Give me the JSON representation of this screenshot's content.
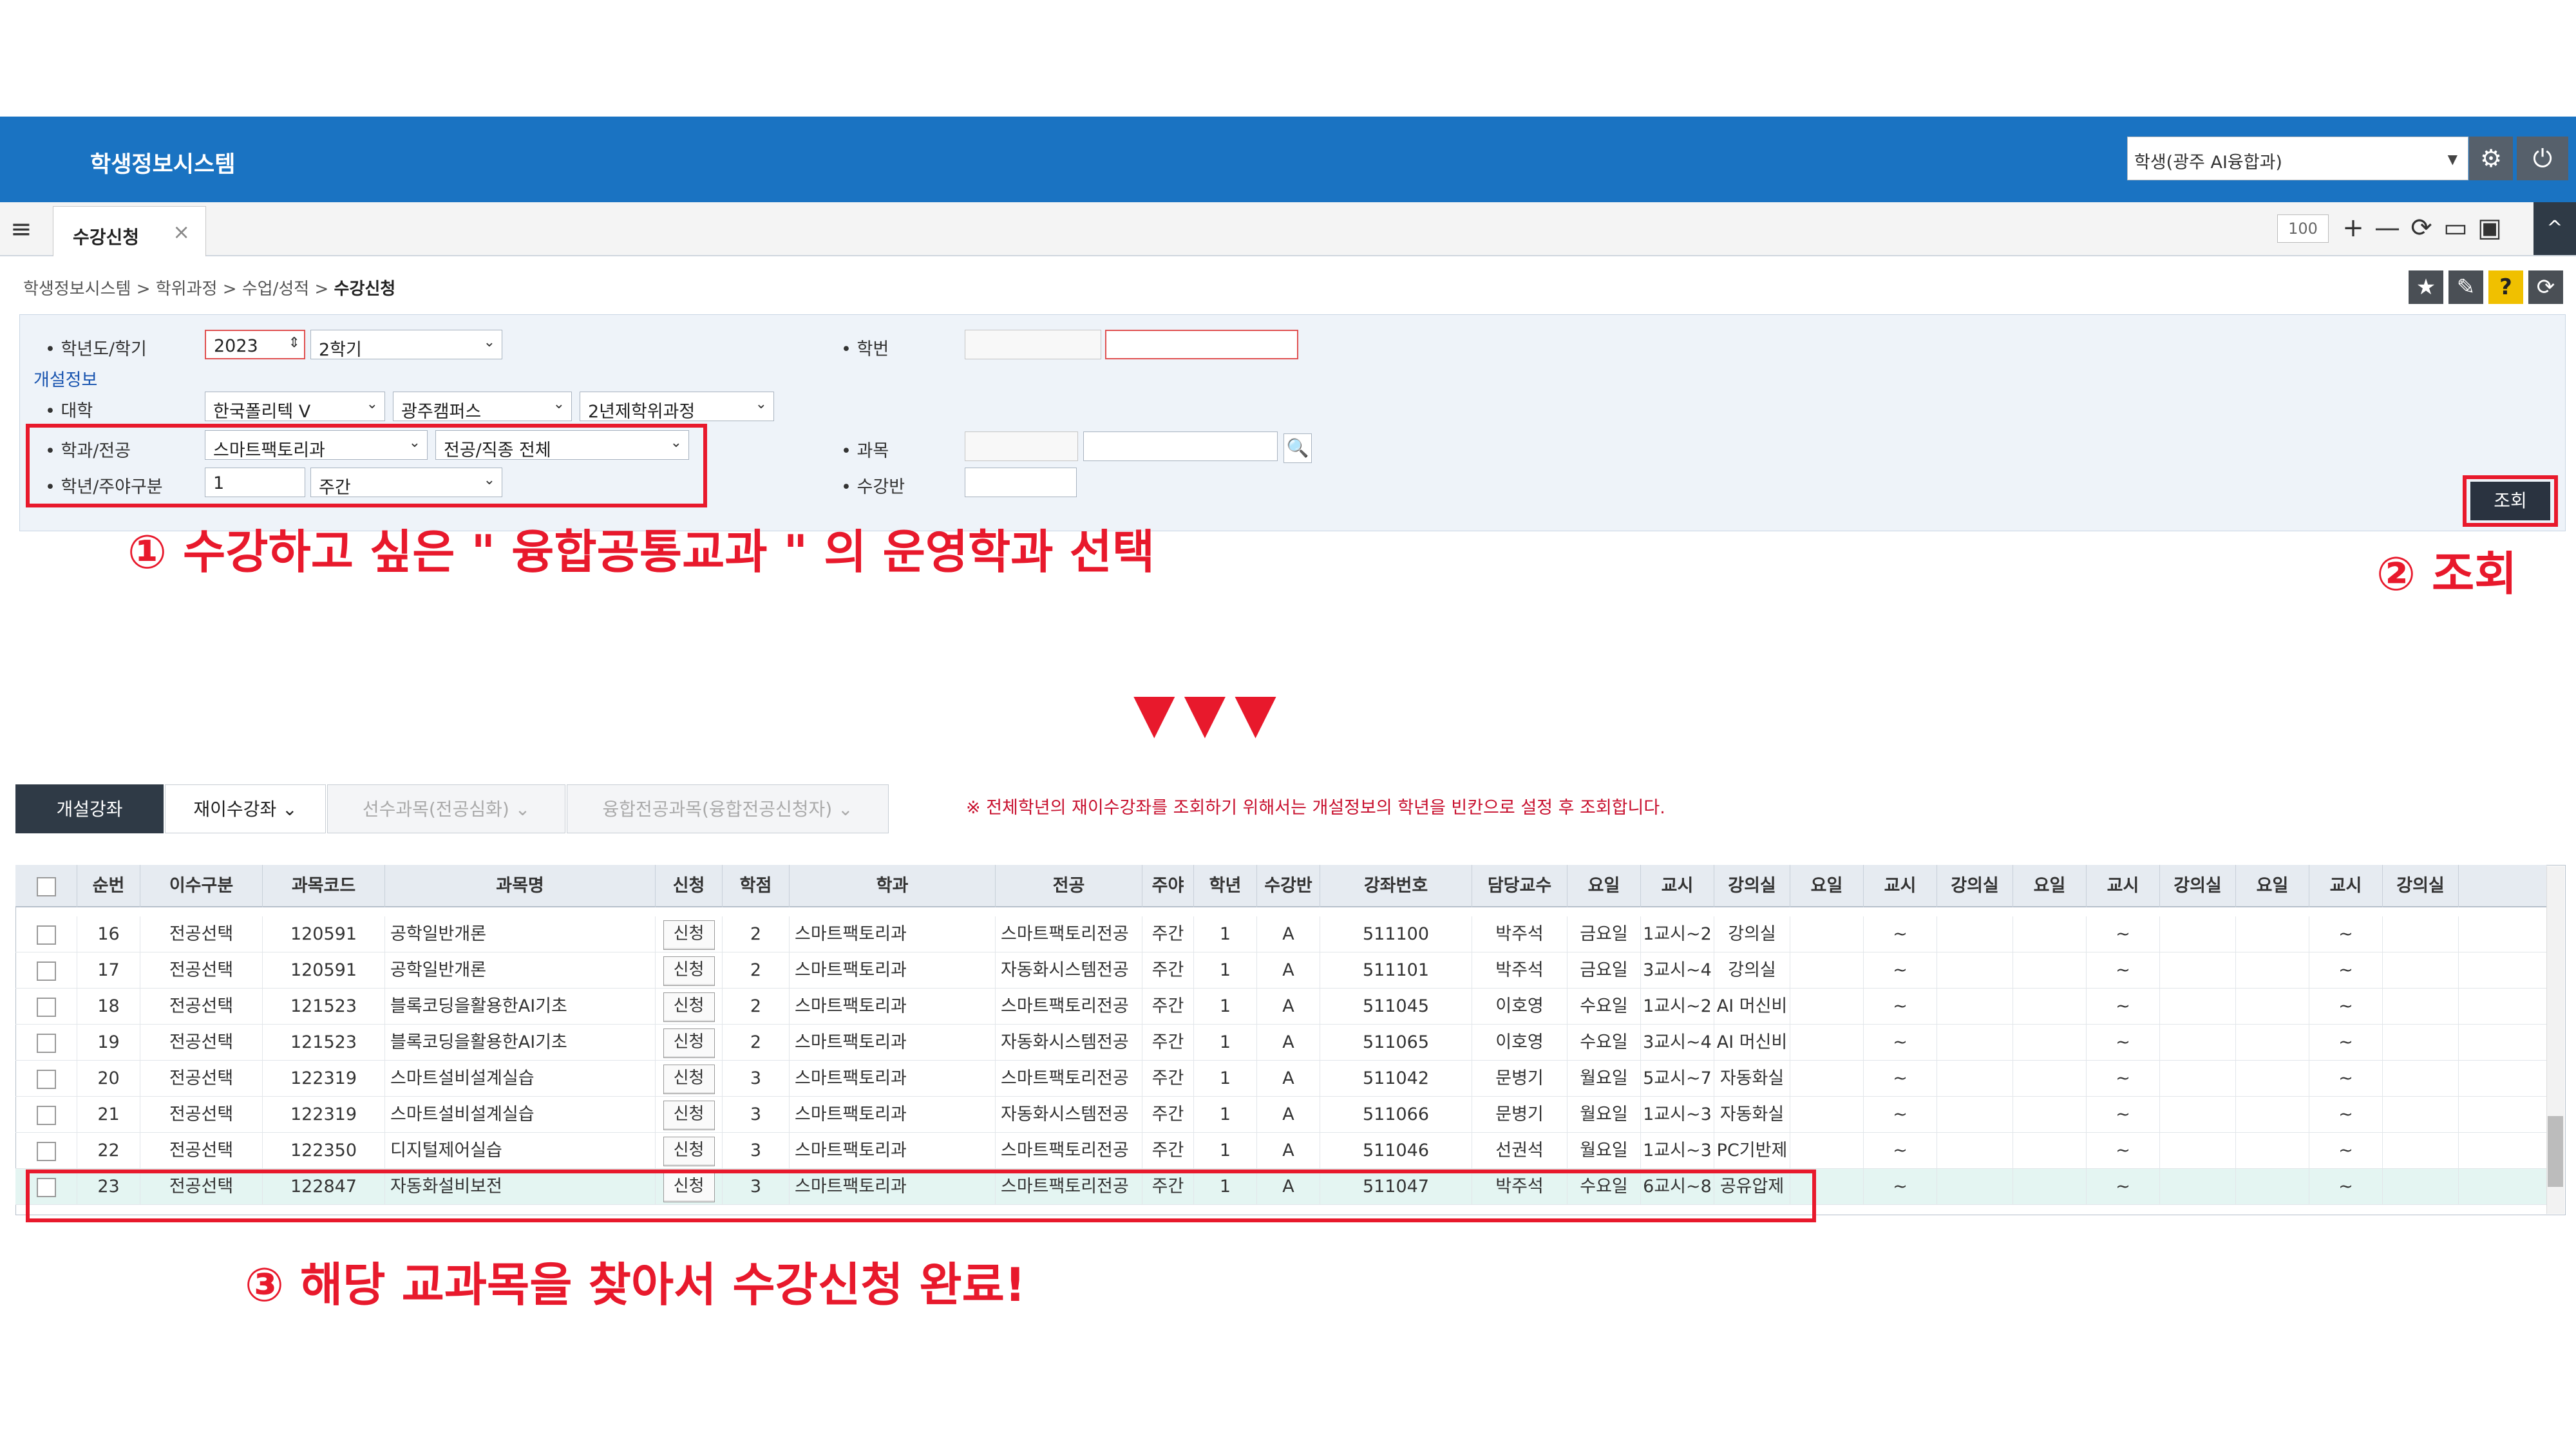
{
  "app": {
    "title": "학생정보시스템",
    "user_selector": "학생(광주 AI융합과)",
    "settings_icon": "gear-icon",
    "power_icon": "power-icon"
  },
  "tabs": {
    "menu_icon": "hamburger-icon",
    "active_tab": "수강신청",
    "close_glyph": "×",
    "zoom": "100",
    "tools": [
      "+",
      "—",
      "⟳",
      "▭",
      "▣"
    ],
    "collapse": "^"
  },
  "breadcrumb": {
    "items": [
      "학생정보시스템 >",
      "학위과정 >",
      "수업/성적 >"
    ],
    "current": "수강신청"
  },
  "right_icons": [
    "★",
    "✎",
    "?",
    "⟳"
  ],
  "form": {
    "year_semester_label": "• 학년도/학기",
    "year": "2023",
    "semester": "2학기",
    "student_no_label": "• 학번",
    "student_no_a": "",
    "student_no_b": "",
    "open_info_label": "개설정보",
    "college_label": "• 대학",
    "college": "한국폴리텍 V",
    "campus": "광주캠퍼스",
    "program": "2년제학위과정",
    "dept_label": "• 학과/전공",
    "dept": "스마트팩토리과",
    "major": "전공/직종 전체",
    "course_label": "• 과목",
    "course_code": "",
    "course_name": "",
    "search_glyph": "🔍",
    "grade_label": "• 학년/주야구분",
    "grade": "1",
    "day_night": "주간",
    "class_label": "• 수강반",
    "class_value": "",
    "query_button": "조회"
  },
  "annotations": {
    "step1": "① 수강하고 싶은 \" 융합공통교과 \" 의 운영학과 선택",
    "step2": "② 조회",
    "arrows": "▼▼▼",
    "step3": "③ 해당 교과목을 찾아서 수강신청 완료!"
  },
  "subtabs": [
    {
      "label": "개설강좌",
      "state": "active"
    },
    {
      "label": "재이수강좌",
      "state": "on"
    },
    {
      "label": "선수과목(전공심화)",
      "state": "off"
    },
    {
      "label": "융합전공과목(융합전공신청자)",
      "state": "off"
    }
  ],
  "subtab_caret": "⌄",
  "notice": "※ 전체학년의 재이수강좌를 조회하기 위해서는 개설정보의 학년을 빈칸으로 설정 후 조회합니다.",
  "table": {
    "headers": [
      "",
      "순번",
      "이수구분",
      "과목코드",
      "과목명",
      "신청",
      "학점",
      "학과",
      "전공",
      "주야",
      "학년",
      "수강반",
      "강좌번호",
      "담당교수",
      "요일",
      "교시",
      "강의실",
      "요일",
      "교시",
      "강의실",
      "요일",
      "교시",
      "강의실",
      "요일",
      "교시",
      "강의실"
    ],
    "apply_label": "신청",
    "rows": [
      [
        "16",
        "전공선택",
        "120591",
        "공학일반개론",
        "2",
        "스마트팩토리과",
        "스마트팩토리전공",
        "주간",
        "1",
        "A",
        "511100",
        "박주석",
        "금요일",
        "1교시~2",
        "강의실",
        "",
        "~",
        "",
        "",
        "~",
        "",
        "",
        "~",
        ""
      ],
      [
        "17",
        "전공선택",
        "120591",
        "공학일반개론",
        "2",
        "스마트팩토리과",
        "자동화시스템전공",
        "주간",
        "1",
        "A",
        "511101",
        "박주석",
        "금요일",
        "3교시~4",
        "강의실",
        "",
        "~",
        "",
        "",
        "~",
        "",
        "",
        "~",
        ""
      ],
      [
        "18",
        "전공선택",
        "121523",
        "블록코딩을활용한AI기초",
        "2",
        "스마트팩토리과",
        "스마트팩토리전공",
        "주간",
        "1",
        "A",
        "511045",
        "이호영",
        "수요일",
        "1교시~2",
        "AI 머신비",
        "",
        "~",
        "",
        "",
        "~",
        "",
        "",
        "~",
        ""
      ],
      [
        "19",
        "전공선택",
        "121523",
        "블록코딩을활용한AI기초",
        "2",
        "스마트팩토리과",
        "자동화시스템전공",
        "주간",
        "1",
        "A",
        "511065",
        "이호영",
        "수요일",
        "3교시~4",
        "AI 머신비",
        "",
        "~",
        "",
        "",
        "~",
        "",
        "",
        "~",
        ""
      ],
      [
        "20",
        "전공선택",
        "122319",
        "스마트설비설계실습",
        "3",
        "스마트팩토리과",
        "스마트팩토리전공",
        "주간",
        "1",
        "A",
        "511042",
        "문병기",
        "월요일",
        "5교시~7",
        "자동화실",
        "",
        "~",
        "",
        "",
        "~",
        "",
        "",
        "~",
        ""
      ],
      [
        "21",
        "전공선택",
        "122319",
        "스마트설비설계실습",
        "3",
        "스마트팩토리과",
        "자동화시스템전공",
        "주간",
        "1",
        "A",
        "511066",
        "문병기",
        "월요일",
        "1교시~3",
        "자동화실",
        "",
        "~",
        "",
        "",
        "~",
        "",
        "",
        "~",
        ""
      ],
      [
        "22",
        "전공선택",
        "122350",
        "디지털제어실습",
        "3",
        "스마트팩토리과",
        "스마트팩토리전공",
        "주간",
        "1",
        "A",
        "511046",
        "선권석",
        "월요일",
        "1교시~3",
        "PC기반제",
        "",
        "~",
        "",
        "",
        "~",
        "",
        "",
        "~",
        ""
      ],
      [
        "23",
        "전공선택",
        "122847",
        "자동화설비보전",
        "3",
        "스마트팩토리과",
        "스마트팩토리전공",
        "주간",
        "1",
        "A",
        "511047",
        "박주석",
        "수요일",
        "6교시~8",
        "공유압제",
        "",
        "~",
        "",
        "",
        "~",
        "",
        "",
        "~",
        ""
      ]
    ]
  },
  "colors": {
    "header_blue": "#1a73c2",
    "annotation_red": "#e8192c",
    "selected_row": "#e4f5f2",
    "dark_button": "#2a3340"
  }
}
